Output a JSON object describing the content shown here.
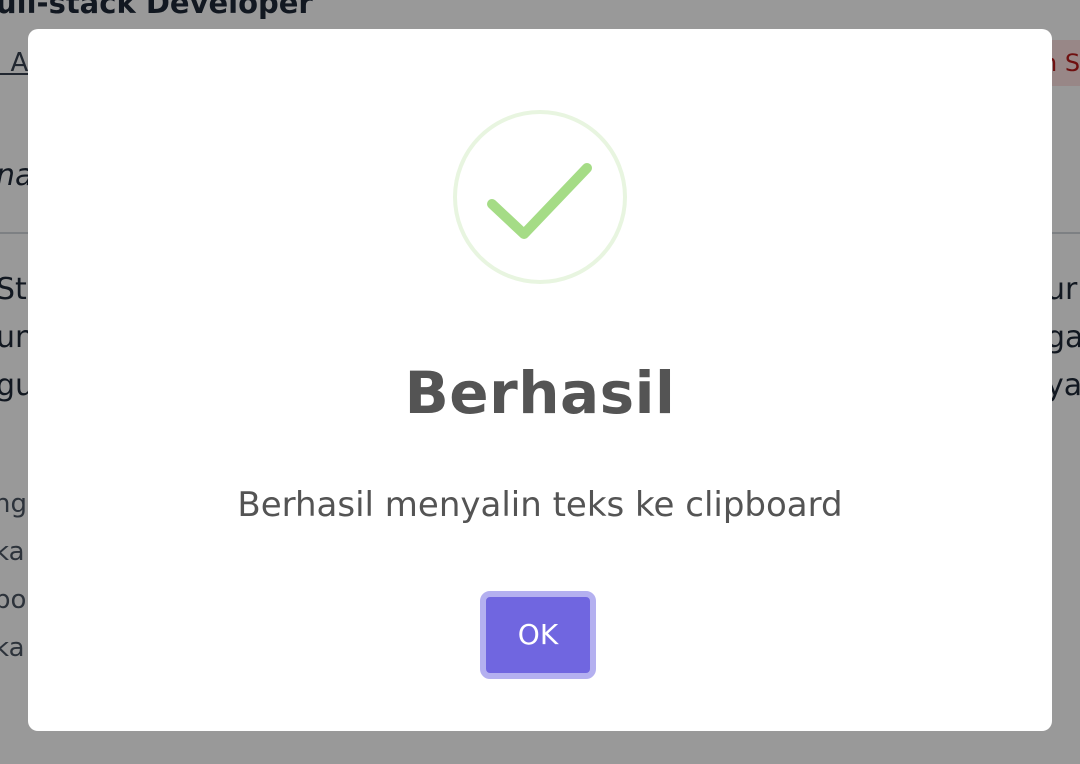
{
  "background": {
    "job_title": "ull-stack Developer",
    "link_text": ". A",
    "tag_text": "n S",
    "italic_text": "na",
    "para_left": [
      "St",
      "un",
      "gu"
    ],
    "para_right": [
      "ur",
      "ga",
      "ya"
    ],
    "list_items": [
      "ng",
      "ka",
      "bo",
      "ka"
    ]
  },
  "dialog": {
    "icon": "check-circle-icon",
    "title": "Berhasil",
    "message": "Berhasil menyalin teks ke clipboard",
    "ok_label": "OK",
    "colors": {
      "icon_ring": "#e8f5e0",
      "icon_check": "#a5dc86",
      "button_bg": "#7066e0",
      "button_focus_ring": "#b4b0f0",
      "text": "#545454"
    }
  }
}
